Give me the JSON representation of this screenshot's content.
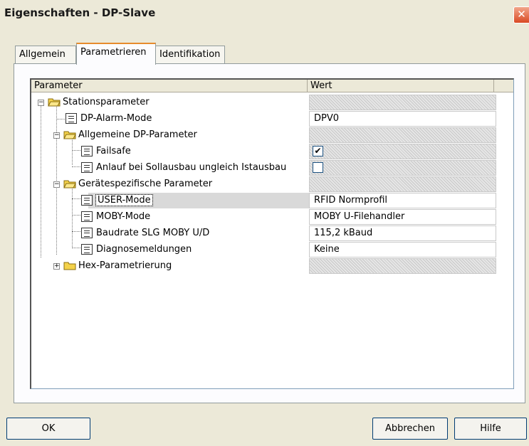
{
  "window": {
    "title": "Eigenschaften - DP-Slave",
    "close_label": "✕"
  },
  "tabs": [
    {
      "label": "Allgemein",
      "active": false
    },
    {
      "label": "Parametrieren",
      "active": true
    },
    {
      "label": "Identifikation",
      "active": false
    }
  ],
  "grid": {
    "columns": [
      "Parameter",
      "Wert"
    ],
    "rows": [
      {
        "label": "Stationsparameter",
        "type": "folder",
        "expanded": true,
        "value": ""
      },
      {
        "label": "DP-Alarm-Mode",
        "type": "param",
        "value": "DPV0"
      },
      {
        "label": "Allgemeine DP-Parameter",
        "type": "folder",
        "expanded": true,
        "value": ""
      },
      {
        "label": "Failsafe",
        "type": "param",
        "value": "",
        "checked": true
      },
      {
        "label": "Anlauf bei Sollausbau ungleich Istausbau",
        "type": "param",
        "value": "",
        "checked": false
      },
      {
        "label": "Gerätespezifische Parameter",
        "type": "folder",
        "expanded": true,
        "value": ""
      },
      {
        "label": "USER-Mode",
        "type": "param",
        "value": "RFID Normprofil",
        "selected": true
      },
      {
        "label": "MOBY-Mode",
        "type": "param",
        "value": "MOBY U-Filehandler"
      },
      {
        "label": "Baudrate SLG MOBY U/D",
        "type": "param",
        "value": "115,2 kBaud"
      },
      {
        "label": "Diagnosemeldungen",
        "type": "param",
        "value": "Keine"
      },
      {
        "label": "Hex-Parametrierung",
        "type": "folder",
        "expanded": false,
        "value": ""
      }
    ],
    "check_mark": "✔"
  },
  "buttons": {
    "ok": "OK",
    "cancel": "Abbrechen",
    "help": "Hilfe"
  },
  "icons": {
    "folder": "folder-icon",
    "param": "document-icon",
    "expand": "+",
    "collapse": "−"
  },
  "colors": {
    "tab_accent": "#e68b2c",
    "folder_yellow": "#f4d24a",
    "close_red": "#d94a24"
  }
}
